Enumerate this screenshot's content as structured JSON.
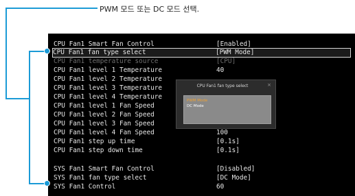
{
  "callout": {
    "text": "PWM 모드 또는 DC 모드 선택."
  },
  "colors": {
    "accent": "#1a9ad6",
    "selected_option": "#f0a232"
  },
  "rows": [
    {
      "label": "CPU Fan1 Smart Fan Control",
      "value": "[Enabled]"
    },
    {
      "label": "CPU Fan1 fan type select",
      "value": "[PWM Mode]"
    },
    {
      "label": "CPU Fan1 temperature source",
      "value": "[CPU]"
    },
    {
      "label": "CPU Fan1 level 1 Temperature",
      "value": "40"
    },
    {
      "label": "CPU Fan1 level 2 Temperature",
      "value": ""
    },
    {
      "label": "CPU Fan1 level 3 Temperature",
      "value": ""
    },
    {
      "label": "CPU Fan1 level 4 Temperature",
      "value": ""
    },
    {
      "label": "CPU Fan1 level 1 Fan Speed",
      "value": ""
    },
    {
      "label": "CPU Fan1 level 2 Fan Speed",
      "value": ""
    },
    {
      "label": "CPU Fan1 level 3 Fan Speed",
      "value": "--"
    },
    {
      "label": "CPU Fan1 level 4 Fan Speed",
      "value": "100"
    },
    {
      "label": "CPU Fan1 step up time",
      "value": "[0.1s]"
    },
    {
      "label": "CPU Fan1 step down time",
      "value": "[0.1s]"
    },
    {
      "label": "SYS Fan1 Smart Fan Control",
      "value": "[Disabled]"
    },
    {
      "label": "SYS Fan1 fan type select",
      "value": "[DC Mode]"
    },
    {
      "label": "SYS Fan1 Control",
      "value": "60"
    }
  ],
  "popup": {
    "title": "CPU Fan1 fan type select",
    "close": "×",
    "options": [
      "PWM Mode",
      "DC Mode"
    ],
    "selected": "PWM Mode"
  }
}
